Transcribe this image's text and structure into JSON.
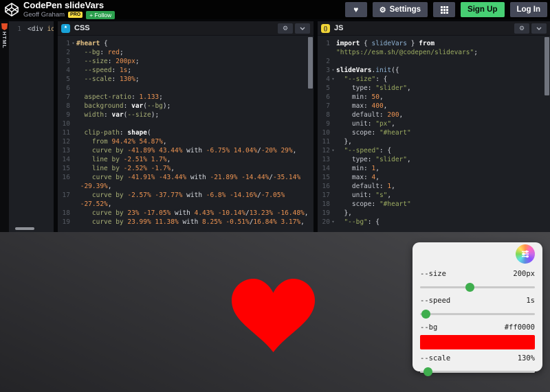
{
  "header": {
    "title": "CodePen slideVars",
    "author": "Geoff Graham",
    "pro_badge": "PRO",
    "follow_button": "+ Follow",
    "settings_button": "Settings",
    "signup_button": "Sign Up",
    "login_button": "Log In"
  },
  "colors": {
    "signup_green": "#47cf73",
    "pro_yellow": "#ffdd40",
    "heart_red": "#ff0000",
    "slider_green": "#3fae4e",
    "css_icon_blue": "#18a2d8",
    "js_icon_yellow": "#f1d537",
    "html_icon_red": "#e44d26"
  },
  "panels": {
    "html": {
      "label": "HTML",
      "lines": [
        {
          "n": "1",
          "t": [
            [
              "<div",
              "tag"
            ],
            [
              " id=",
              "attr"
            ]
          ]
        }
      ]
    },
    "css": {
      "label": "CSS",
      "lines": [
        {
          "n": "1",
          "fold": true,
          "t": [
            [
              "#heart",
              "sel"
            ],
            [
              " {",
              "w"
            ]
          ]
        },
        {
          "n": "2",
          "t": [
            [
              "  --bg",
              "k"
            ],
            [
              ": ",
              "w"
            ],
            [
              "red",
              "v"
            ],
            [
              ";",
              "w"
            ]
          ]
        },
        {
          "n": "3",
          "t": [
            [
              "  --size",
              "k"
            ],
            [
              ": ",
              "w"
            ],
            [
              "200px",
              "v"
            ],
            [
              ";",
              "w"
            ]
          ]
        },
        {
          "n": "4",
          "t": [
            [
              "  --speed",
              "k"
            ],
            [
              ": ",
              "w"
            ],
            [
              "1s",
              "v"
            ],
            [
              ";",
              "w"
            ]
          ]
        },
        {
          "n": "5",
          "t": [
            [
              "  --scale",
              "k"
            ],
            [
              ": ",
              "w"
            ],
            [
              "130%",
              "v"
            ],
            [
              ";",
              "w"
            ]
          ]
        },
        {
          "n": "6",
          "t": []
        },
        {
          "n": "7",
          "t": [
            [
              "  aspect-ratio",
              "k"
            ],
            [
              ": ",
              "w"
            ],
            [
              "1.133",
              "v"
            ],
            [
              ";",
              "w"
            ]
          ]
        },
        {
          "n": "8",
          "t": [
            [
              "  background",
              "k"
            ],
            [
              ": ",
              "w"
            ],
            [
              "var",
              "b"
            ],
            [
              "(",
              "w"
            ],
            [
              "--bg",
              "k"
            ],
            [
              ")",
              "w"
            ],
            [
              ";",
              "w"
            ]
          ]
        },
        {
          "n": "9",
          "t": [
            [
              "  width",
              "k"
            ],
            [
              ": ",
              "w"
            ],
            [
              "var",
              "b"
            ],
            [
              "(",
              "w"
            ],
            [
              "--size",
              "k"
            ],
            [
              ")",
              "w"
            ],
            [
              ";",
              "w"
            ]
          ]
        },
        {
          "n": "10",
          "t": []
        },
        {
          "n": "11",
          "t": [
            [
              "  clip-path",
              "k"
            ],
            [
              ": ",
              "w"
            ],
            [
              "shape",
              "b"
            ],
            [
              "(",
              "w"
            ]
          ]
        },
        {
          "n": "12",
          "t": [
            [
              "    from ",
              "k"
            ],
            [
              "94.42% 54.87%",
              "v"
            ],
            [
              ",",
              "w"
            ]
          ]
        },
        {
          "n": "13",
          "t": [
            [
              "    curve by ",
              "k"
            ],
            [
              "-41.89% 43.44%",
              "v"
            ],
            [
              " with ",
              "w"
            ],
            [
              "-6.75% 14.04%",
              "v"
            ],
            [
              "/",
              "w"
            ],
            [
              "-20% 29%",
              "v"
            ],
            [
              ",",
              "w"
            ]
          ]
        },
        {
          "n": "14",
          "t": [
            [
              "    line by ",
              "k"
            ],
            [
              "-2.51% 1.7%",
              "v"
            ],
            [
              ",",
              "w"
            ]
          ]
        },
        {
          "n": "15",
          "t": [
            [
              "    line by ",
              "k"
            ],
            [
              "-2.52% -1.7%",
              "v"
            ],
            [
              ",",
              "w"
            ]
          ]
        },
        {
          "n": "16",
          "t": [
            [
              "    curve by ",
              "k"
            ],
            [
              "-41.91% -43.44%",
              "v"
            ],
            [
              " with ",
              "w"
            ],
            [
              "-21.89% -14.44%",
              "v"
            ],
            [
              "/",
              "w"
            ],
            [
              "-35.14%",
              "v"
            ]
          ]
        },
        {
          "n": "",
          "t": [
            [
              " -29.39%",
              "v"
            ],
            [
              ",",
              "w"
            ]
          ]
        },
        {
          "n": "17",
          "t": [
            [
              "    curve by ",
              "k"
            ],
            [
              "-2.57% -37.77%",
              "v"
            ],
            [
              " with ",
              "w"
            ],
            [
              "-6.8% -14.16%",
              "v"
            ],
            [
              "/",
              "w"
            ],
            [
              "-7.05%",
              "v"
            ]
          ]
        },
        {
          "n": "",
          "t": [
            [
              " -27.52%",
              "v"
            ],
            [
              ",",
              "w"
            ]
          ]
        },
        {
          "n": "18",
          "t": [
            [
              "    curve by ",
              "k"
            ],
            [
              "23% -17.05%",
              "v"
            ],
            [
              " with ",
              "w"
            ],
            [
              "4.43% -10.14%",
              "v"
            ],
            [
              "/",
              "w"
            ],
            [
              "13.23% -16.48%",
              "v"
            ],
            [
              ",",
              "w"
            ]
          ]
        },
        {
          "n": "19",
          "t": [
            [
              "    curve by ",
              "k"
            ],
            [
              "23.99% 11.38%",
              "v"
            ],
            [
              " with ",
              "w"
            ],
            [
              "8.25% -0.51%",
              "v"
            ],
            [
              "/",
              "w"
            ],
            [
              "16.84% 3.17%",
              "v"
            ],
            [
              ",",
              "w"
            ]
          ]
        }
      ]
    },
    "js": {
      "label": "JS",
      "lines": [
        {
          "n": "1",
          "t": [
            [
              "import",
              "b"
            ],
            [
              " { ",
              "w"
            ],
            [
              "slideVars",
              "i"
            ],
            [
              " } ",
              "w"
            ],
            [
              "from",
              "b"
            ]
          ]
        },
        {
          "n": "",
          "t": [
            [
              "\"https://esm.sh/@codepen/slidevars\"",
              "s"
            ],
            [
              ";",
              "w"
            ]
          ]
        },
        {
          "n": "2",
          "t": []
        },
        {
          "n": "3",
          "fold": true,
          "t": [
            [
              "slideVars",
              "b"
            ],
            [
              ".",
              "w"
            ],
            [
              "init",
              "i"
            ],
            [
              "({",
              "w"
            ]
          ]
        },
        {
          "n": "4",
          "fold": true,
          "t": [
            [
              "  \"--size\"",
              "s"
            ],
            [
              ": {",
              "w"
            ]
          ]
        },
        {
          "n": "5",
          "t": [
            [
              "    type",
              "g"
            ],
            [
              ": ",
              "w"
            ],
            [
              "\"slider\"",
              "s"
            ],
            [
              ",",
              "w"
            ]
          ]
        },
        {
          "n": "6",
          "t": [
            [
              "    min",
              "g"
            ],
            [
              ": ",
              "w"
            ],
            [
              "50",
              "v"
            ],
            [
              ",",
              "w"
            ]
          ]
        },
        {
          "n": "7",
          "t": [
            [
              "    max",
              "g"
            ],
            [
              ": ",
              "w"
            ],
            [
              "400",
              "v"
            ],
            [
              ",",
              "w"
            ]
          ]
        },
        {
          "n": "8",
          "t": [
            [
              "    default",
              "g"
            ],
            [
              ": ",
              "w"
            ],
            [
              "200",
              "v"
            ],
            [
              ",",
              "w"
            ]
          ]
        },
        {
          "n": "9",
          "t": [
            [
              "    unit",
              "g"
            ],
            [
              ": ",
              "w"
            ],
            [
              "\"px\"",
              "s"
            ],
            [
              ",",
              "w"
            ]
          ]
        },
        {
          "n": "10",
          "t": [
            [
              "    scope",
              "g"
            ],
            [
              ": ",
              "w"
            ],
            [
              "\"#heart\"",
              "s"
            ]
          ]
        },
        {
          "n": "11",
          "t": [
            [
              "  },",
              "w"
            ]
          ]
        },
        {
          "n": "12",
          "fold": true,
          "t": [
            [
              "  \"--speed\"",
              "s"
            ],
            [
              ": {",
              "w"
            ]
          ]
        },
        {
          "n": "13",
          "t": [
            [
              "    type",
              "g"
            ],
            [
              ": ",
              "w"
            ],
            [
              "\"slider\"",
              "s"
            ],
            [
              ",",
              "w"
            ]
          ]
        },
        {
          "n": "14",
          "t": [
            [
              "    min",
              "g"
            ],
            [
              ": ",
              "w"
            ],
            [
              "1",
              "v"
            ],
            [
              ",",
              "w"
            ]
          ]
        },
        {
          "n": "15",
          "t": [
            [
              "    max",
              "g"
            ],
            [
              ": ",
              "w"
            ],
            [
              "4",
              "v"
            ],
            [
              ",",
              "w"
            ]
          ]
        },
        {
          "n": "16",
          "t": [
            [
              "    default",
              "g"
            ],
            [
              ": ",
              "w"
            ],
            [
              "1",
              "v"
            ],
            [
              ",",
              "w"
            ]
          ]
        },
        {
          "n": "17",
          "t": [
            [
              "    unit",
              "g"
            ],
            [
              ": ",
              "w"
            ],
            [
              "\"s\"",
              "s"
            ],
            [
              ",",
              "w"
            ]
          ]
        },
        {
          "n": "18",
          "t": [
            [
              "    scope",
              "g"
            ],
            [
              ": ",
              "w"
            ],
            [
              "\"#heart\"",
              "s"
            ]
          ]
        },
        {
          "n": "19",
          "t": [
            [
              "  },",
              "w"
            ]
          ]
        },
        {
          "n": "20",
          "fold": true,
          "t": [
            [
              "  \"--bg\"",
              "s"
            ],
            [
              ": {",
              "w"
            ]
          ]
        }
      ]
    }
  },
  "preview": {
    "heart_color": "#ff0000",
    "controls": {
      "rows": [
        {
          "label": "--size",
          "value": "200px",
          "type": "slider",
          "thumb_pct": 43
        },
        {
          "label": "--speed",
          "value": "1s",
          "type": "slider",
          "thumb_pct": 1
        },
        {
          "label": "--bg",
          "value": "#ff0000",
          "type": "swatch",
          "swatch_color": "#ff0000"
        },
        {
          "label": "--scale",
          "value": "130%",
          "type": "slider",
          "thumb_pct": 3
        }
      ]
    }
  }
}
